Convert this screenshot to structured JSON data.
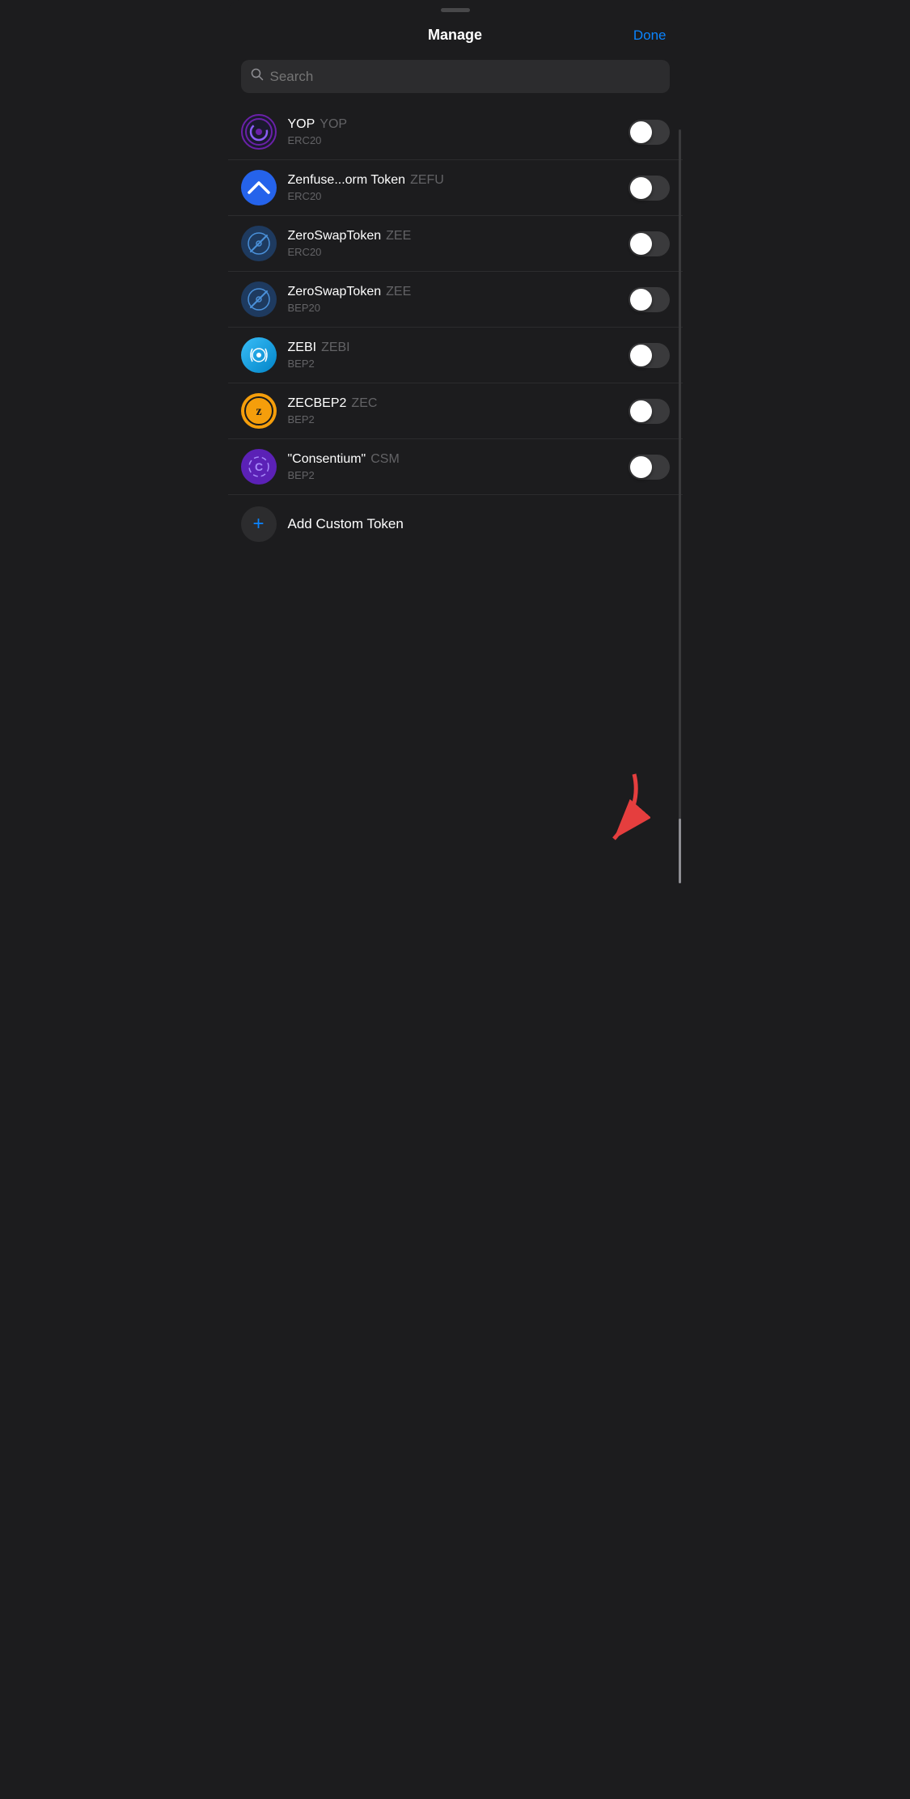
{
  "header": {
    "title": "Manage",
    "done_label": "Done"
  },
  "search": {
    "placeholder": "Search"
  },
  "tokens": [
    {
      "id": "yop",
      "name": "YOP",
      "ticker": "YOP",
      "network": "ERC20",
      "enabled": false,
      "icon_type": "yop"
    },
    {
      "id": "zefu",
      "name": "Zenfuse...orm Token",
      "ticker": "ZEFU",
      "network": "ERC20",
      "enabled": false,
      "icon_type": "zenfuse"
    },
    {
      "id": "zee-erc20",
      "name": "ZeroSwapToken",
      "ticker": "ZEE",
      "network": "ERC20",
      "enabled": false,
      "icon_type": "zeroswap"
    },
    {
      "id": "zee-bep20",
      "name": "ZeroSwapToken",
      "ticker": "ZEE",
      "network": "BEP20",
      "enabled": false,
      "icon_type": "zeroswap"
    },
    {
      "id": "zebi",
      "name": "ZEBI",
      "ticker": "ZEBI",
      "network": "BEP2",
      "enabled": false,
      "icon_type": "zebi"
    },
    {
      "id": "zec",
      "name": "ZECBEP2",
      "ticker": "ZEC",
      "network": "BEP2",
      "enabled": false,
      "icon_type": "zec"
    },
    {
      "id": "csm",
      "name": "“Consentium”",
      "ticker": "CSM",
      "network": "BEP2",
      "enabled": false,
      "icon_type": "csm"
    }
  ],
  "add_custom": {
    "label": "Add Custom Token"
  },
  "colors": {
    "accent": "#0a84ff",
    "background": "#1c1c1e",
    "toggle_off": "#3a3a3c",
    "separator": "#2c2c2e",
    "ticker_color": "#636366",
    "red_arrow": "#e53e3e"
  }
}
